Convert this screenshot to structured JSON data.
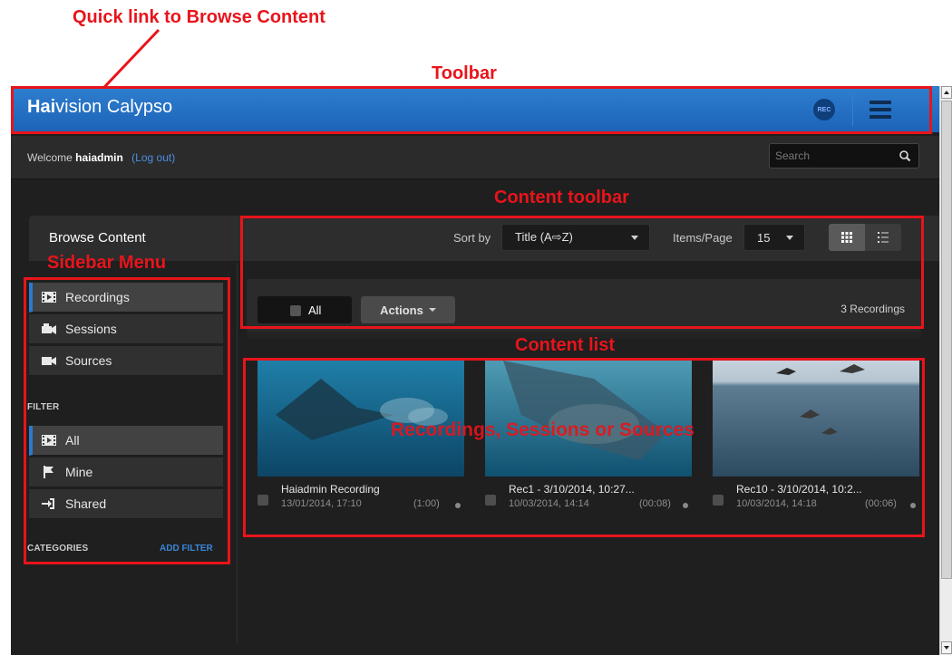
{
  "annotations": {
    "quick_link": "Quick link to Browse Content",
    "toolbar": "Toolbar",
    "content_toolbar": "Content toolbar",
    "sidebar_menu": "Sidebar Menu",
    "content_list": "Content list",
    "cards_caption": "Recordings, Sessions or Sources",
    "color": "#e8141b"
  },
  "app": {
    "brand_bold": "Hai",
    "brand_rest": "vision Calypso",
    "rec_badge": "REC",
    "menu_icon": "hamburger-icon"
  },
  "userbar": {
    "welcome": "Welcome",
    "username": "haiadmin",
    "logout": "(Log out)",
    "search_placeholder": "Search",
    "search_icon": "search-icon"
  },
  "sidebar": {
    "title": "Browse Content",
    "items": [
      {
        "label": "Recordings",
        "icon": "film-icon",
        "active": true
      },
      {
        "label": "Sessions",
        "icon": "session-camera-icon",
        "active": false
      },
      {
        "label": "Sources",
        "icon": "video-camera-icon",
        "active": false
      }
    ],
    "filter_label": "FILTER",
    "filters": [
      {
        "label": "All",
        "icon": "film-icon",
        "active": true
      },
      {
        "label": "Mine",
        "icon": "flag-icon",
        "active": false
      },
      {
        "label": "Shared",
        "icon": "share-in-icon",
        "active": false
      }
    ],
    "categories_label": "CATEGORIES",
    "add_filter": "ADD FILTER"
  },
  "toolbar": {
    "sort_label": "Sort by",
    "sort_value": "Title (A⇨Z)",
    "items_label": "Items/Page",
    "items_value": "15",
    "grid_view_icon": "grid-view-icon",
    "list_view_icon": "list-view-icon"
  },
  "selection": {
    "all_label": "All",
    "actions_label": "Actions",
    "count": "3 Recordings"
  },
  "recordings": [
    {
      "title": "Haiadmin Recording",
      "date": "13/01/2014, 17:10",
      "duration": "(1:00)"
    },
    {
      "title": "Rec1 - 3/10/2014, 10:27...",
      "date": "10/03/2014, 14:14",
      "duration": "(00:08)"
    },
    {
      "title": "Rec10 - 3/10/2014, 10:2...",
      "date": "10/03/2014, 14:18",
      "duration": "(00:06)"
    }
  ],
  "colors": {
    "accent_blue": "#1c63b7",
    "panel_dark": "#1f1f1f"
  }
}
